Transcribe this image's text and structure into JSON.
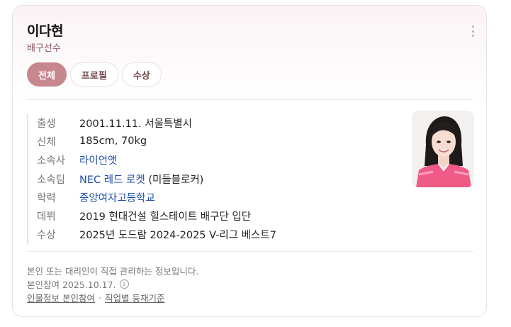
{
  "profile": {
    "name": "이다현",
    "category": "배구선수"
  },
  "tabs": [
    {
      "label": "전체",
      "active": true
    },
    {
      "label": "프로필",
      "active": false
    },
    {
      "label": "수상",
      "active": false
    }
  ],
  "info": [
    {
      "label": "출생",
      "value": "2001.11.11. 서울특별시"
    },
    {
      "label": "신체",
      "value": "185cm, 70kg"
    },
    {
      "label": "소속사",
      "link": "라이언앳"
    },
    {
      "label": "소속팀",
      "link": "NEC 레드 로켓",
      "value": " (미들블로커)"
    },
    {
      "label": "학력",
      "link": "중앙여자고등학교"
    },
    {
      "label": "데뷔",
      "value": "2019 현대건설 힐스테이트 배구단 입단"
    },
    {
      "label": "수상",
      "value": "2025년 도드람 2024-2025 V-리그 베스트7"
    }
  ],
  "footer": {
    "notice": "본인 또는 대리인이 직접 관리하는 정보입니다.",
    "participation": "본인참여 2025.10.17.",
    "info_icon": "i",
    "link1": "인물정보 본인참여",
    "separator": "·",
    "link2": "직업별 등재기준"
  },
  "icons": {
    "more": "more-vertical-icon",
    "info": "info-circle-icon"
  },
  "colors": {
    "accent": "#c6878d",
    "link": "#1f4fa8",
    "subtitle": "#8a5a5f"
  }
}
